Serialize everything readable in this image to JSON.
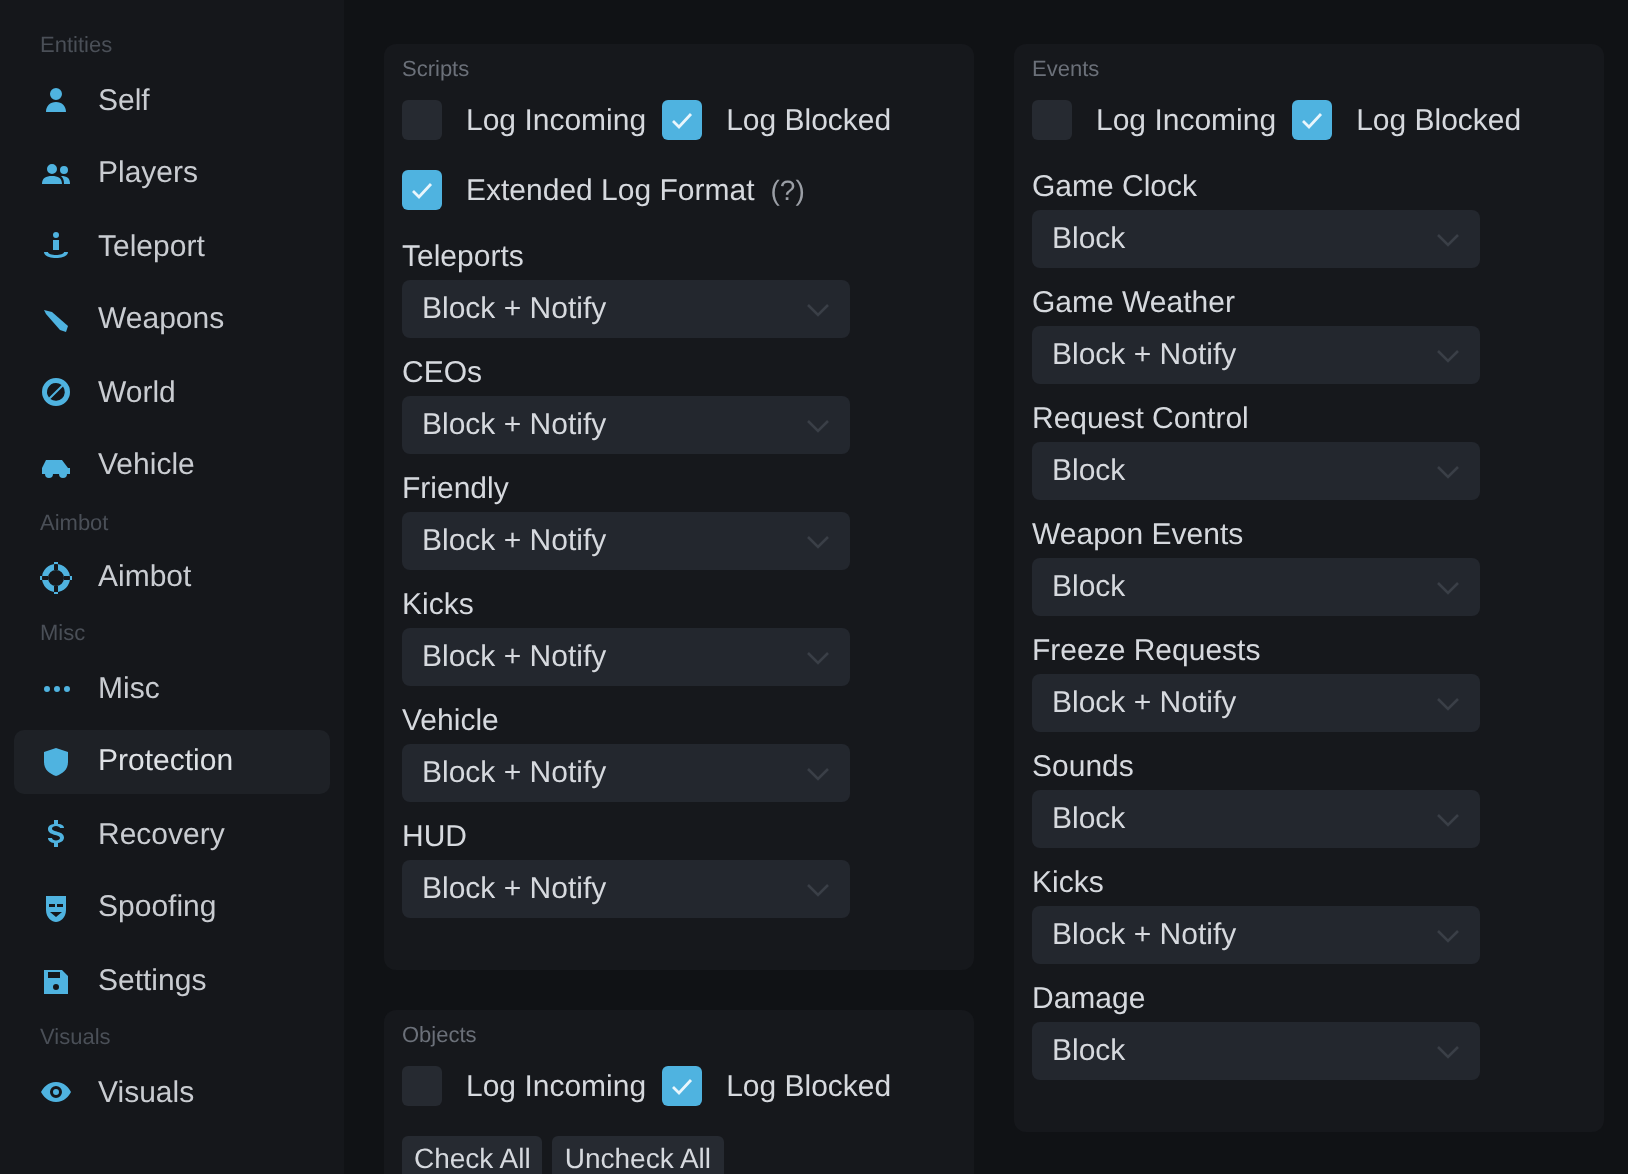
{
  "sidebar": {
    "sections": [
      {
        "title": "Entities",
        "items": [
          {
            "label": "Self",
            "selected": false
          },
          {
            "label": "Players",
            "selected": false
          },
          {
            "label": "Teleport",
            "selected": false
          },
          {
            "label": "Weapons",
            "selected": false
          },
          {
            "label": "World",
            "selected": false
          },
          {
            "label": "Vehicle",
            "selected": false
          }
        ]
      },
      {
        "title": "Aimbot",
        "items": [
          {
            "label": "Aimbot",
            "selected": false
          }
        ]
      },
      {
        "title": "Misc",
        "items": [
          {
            "label": "Misc",
            "selected": false
          },
          {
            "label": "Protection",
            "selected": true
          },
          {
            "label": "Recovery",
            "selected": false
          },
          {
            "label": "Spoofing",
            "selected": false
          },
          {
            "label": "Settings",
            "selected": false
          }
        ]
      },
      {
        "title": "Visuals",
        "items": [
          {
            "label": "Visuals",
            "selected": false
          }
        ]
      }
    ]
  },
  "columns": [
    [
      {
        "title": "Scripts",
        "checkrows": [
          [
            {
              "label": "Log Incoming",
              "checked": false
            },
            {
              "label": "Log Blocked",
              "checked": true
            }
          ],
          [
            {
              "label": "Extended Log Format",
              "checked": true,
              "hint": "(?)"
            }
          ]
        ],
        "selects": [
          {
            "label": "Teleports",
            "value": "Block + Notify"
          },
          {
            "label": "CEOs",
            "value": "Block + Notify"
          },
          {
            "label": "Friendly",
            "value": "Block + Notify"
          },
          {
            "label": "Kicks",
            "value": "Block + Notify"
          },
          {
            "label": "Vehicle",
            "value": "Block + Notify"
          },
          {
            "label": "HUD",
            "value": "Block + Notify"
          }
        ]
      },
      {
        "title": "Objects",
        "checkrows": [
          [
            {
              "label": "Log Incoming",
              "checked": false
            },
            {
              "label": "Log Blocked",
              "checked": true
            }
          ]
        ],
        "buttons": [
          "Check All",
          "Uncheck All"
        ]
      }
    ],
    [
      {
        "title": "Events",
        "checkrows": [
          [
            {
              "label": "Log Incoming",
              "checked": false
            },
            {
              "label": "Log Blocked",
              "checked": true
            }
          ]
        ],
        "selects": [
          {
            "label": "Game Clock",
            "value": "Block"
          },
          {
            "label": "Game Weather",
            "value": "Block + Notify"
          },
          {
            "label": "Request Control",
            "value": "Block"
          },
          {
            "label": "Weapon Events",
            "value": "Block"
          },
          {
            "label": "Freeze Requests",
            "value": "Block + Notify"
          },
          {
            "label": "Sounds",
            "value": "Block"
          },
          {
            "label": "Kicks",
            "value": "Block + Notify"
          },
          {
            "label": "Damage",
            "value": "Block"
          }
        ]
      }
    ]
  ]
}
